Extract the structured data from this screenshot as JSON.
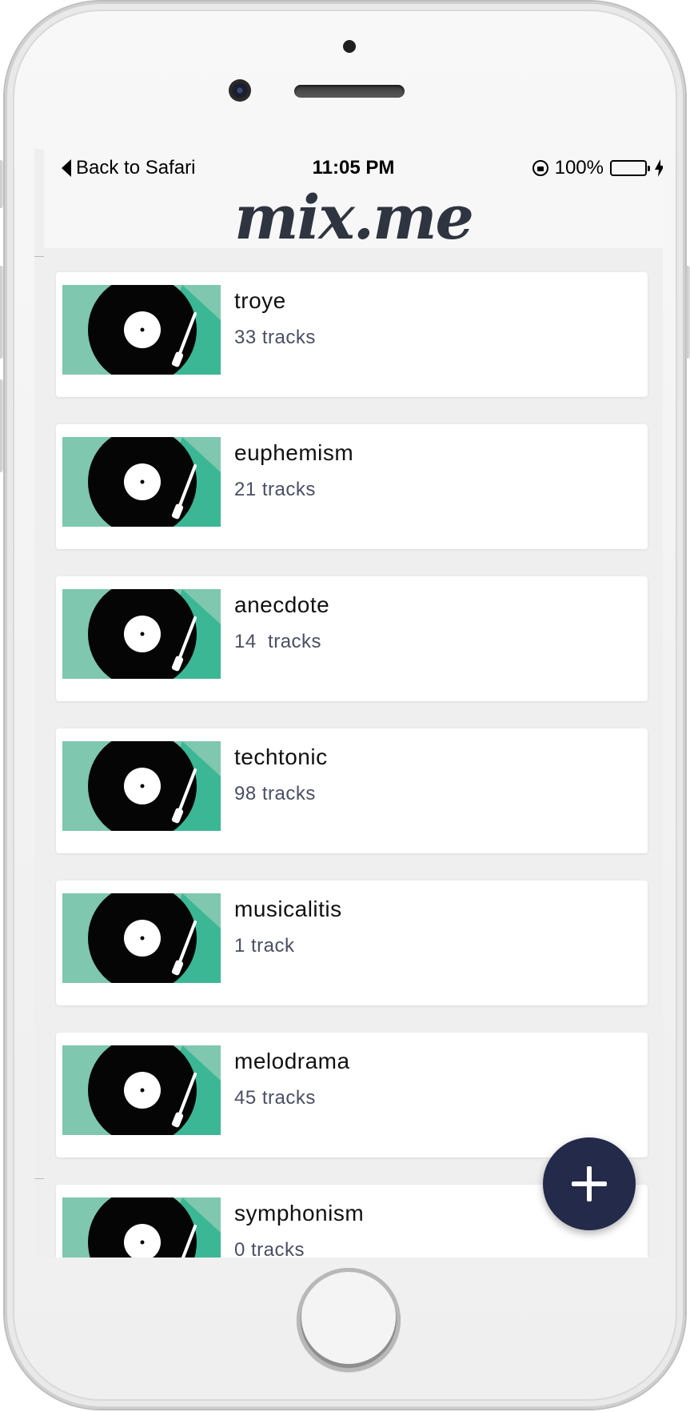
{
  "status_bar": {
    "back_label": "Back to Safari",
    "time": "11:05 PM",
    "battery": "100%",
    "battery_level": 1.0,
    "battery_color": "#4cd964"
  },
  "header": {
    "logo": "mix.me",
    "logo_color": "#2e3440"
  },
  "playlists": [
    {
      "title": "troye",
      "subtitle": "33 tracks"
    },
    {
      "title": "euphemism",
      "subtitle": "21 tracks"
    },
    {
      "title": "anecdote",
      "subtitle": "14  tracks"
    },
    {
      "title": "techtonic",
      "subtitle": "98 tracks"
    },
    {
      "title": "musicalitis",
      "subtitle": "1 track"
    },
    {
      "title": "melodrama",
      "subtitle": "45 tracks"
    },
    {
      "title": "symphonism",
      "subtitle": "0 tracks"
    }
  ],
  "thumbnail": {
    "icon": "vinyl-record-icon",
    "bg_light": "#7fc7ae",
    "bg_dark": "#3bb795"
  },
  "fab": {
    "icon": "plus-icon",
    "color": "#242a4a"
  }
}
